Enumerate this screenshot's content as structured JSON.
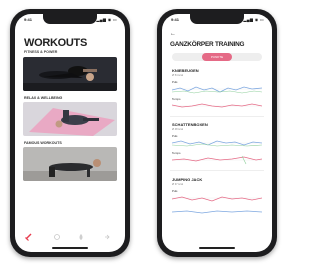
{
  "status": {
    "time": "9:41",
    "icons": "▂▄▆ ◉ ▭"
  },
  "left": {
    "title": "WORKOUTS",
    "subtitle": "FITNESS & POWER",
    "sections": [
      {
        "label": "RELAX & WELLBEING"
      },
      {
        "label": "FAMOUS WORKOUTS"
      }
    ]
  },
  "right": {
    "back": "←",
    "title": "GANZKÖRPER TRAINING",
    "segments": [
      "",
      "PUNKTE",
      ""
    ],
    "exercises": [
      {
        "name": "KNIEBEUGEN",
        "sub": "Ø 54 kcal",
        "metric_a": "Puls",
        "metric_b": "Tempo"
      },
      {
        "name": "SCHATTENBOXEN",
        "sub": "Ø 48 kcal",
        "metric_a": "Puls",
        "metric_b": "Tempo"
      },
      {
        "name": "JUMPING JACK",
        "sub": "Ø 37 kcal",
        "metric_a": "Puls",
        "metric_b": ""
      }
    ]
  },
  "colors": {
    "accent": "#e73c4e",
    "pink": "#e56a86",
    "blue_line": "#7da7e0",
    "green_line": "#8fcf9c"
  },
  "icons": {
    "tab_1": "dumbbell-icon",
    "tab_2": "clock-icon",
    "tab_3": "fire-icon",
    "tab_4": "arrow-icon"
  }
}
